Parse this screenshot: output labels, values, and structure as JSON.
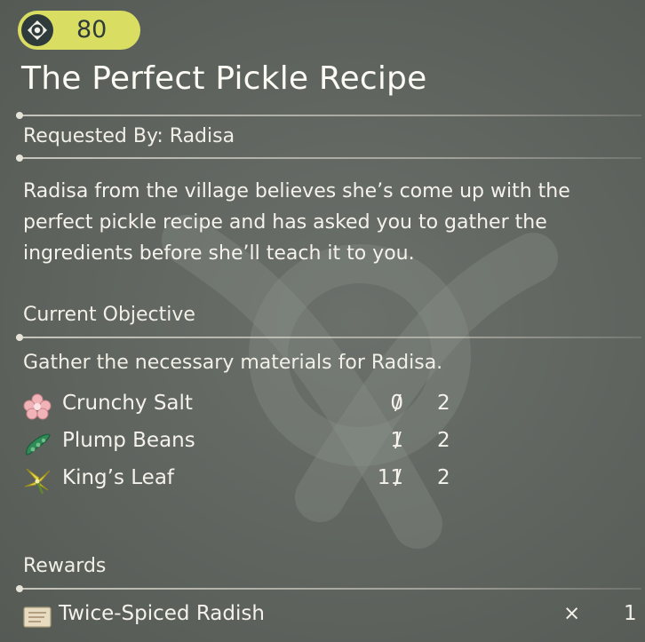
{
  "badge": {
    "value": "80",
    "icon": "target-emblem-icon"
  },
  "request": {
    "title": "The Perfect Pickle Recipe",
    "requested_by": "Requested By: Radisa",
    "description": "Radisa from the village believes she’s come up with the perfect pickle recipe and has asked you to gather the ingredients before she’ll teach it to you."
  },
  "objective": {
    "heading": "Current Objective",
    "text": "Gather the necessary materials for Radisa.",
    "items": [
      {
        "name": "Crunchy Salt",
        "current": "0",
        "separator": "/",
        "total": "2",
        "icon": "crunchy-salt-icon"
      },
      {
        "name": "Plump Beans",
        "current": "1",
        "separator": "/",
        "total": "2",
        "icon": "plump-beans-icon"
      },
      {
        "name": "King’s Leaf",
        "current": "11",
        "separator": "/",
        "total": "2",
        "icon": "kings-leaf-icon"
      }
    ]
  },
  "rewards": {
    "heading": "Rewards",
    "items": [
      {
        "name": "Twice-Spiced Radish",
        "times": "×",
        "quantity": "1",
        "icon": "recipe-scroll-icon"
      }
    ]
  },
  "colors": {
    "badge": "#d9de63",
    "badge_text": "#2f3a3b",
    "background": "#5f645f",
    "text": "#f4f2ea"
  }
}
